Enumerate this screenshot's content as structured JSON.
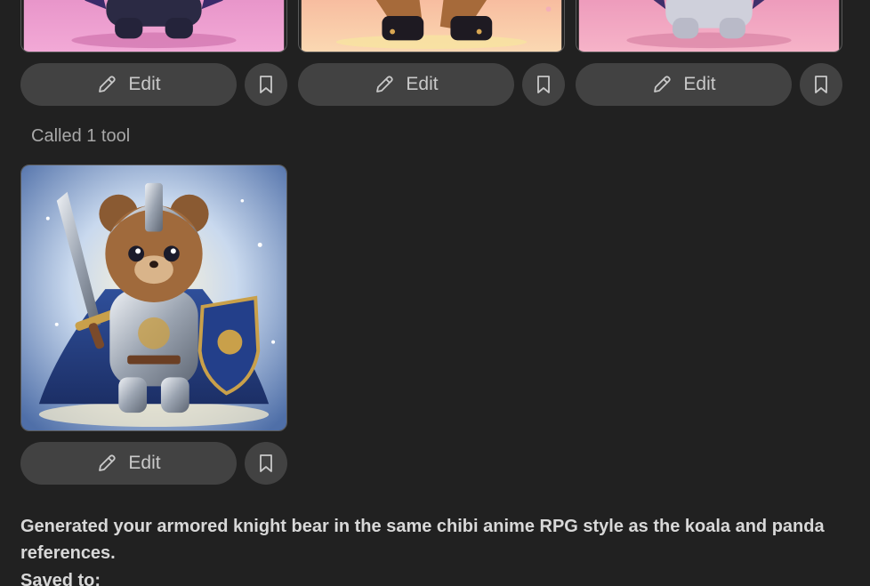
{
  "colors": {
    "background": "#212121",
    "button_bg": "#424242",
    "text_primary": "#d8d8d8",
    "text_muted": "#a8a8a8"
  },
  "gallery_top": {
    "images": [
      {
        "alt": "panda chibi character on pink background"
      },
      {
        "alt": "chibi character in furry boots on peach background"
      },
      {
        "alt": "koala chibi character on pink background"
      }
    ],
    "edit_label": "Edit",
    "edit_icon": "pencil-icon",
    "save_icon": "bookmark-icon"
  },
  "tool_note": "Called 1 tool",
  "generated": {
    "image_alt": "chibi armored knight bear with sword and lion shield",
    "edit_label": "Edit",
    "edit_icon": "pencil-icon",
    "save_icon": "bookmark-icon"
  },
  "assistant_message": "Generated your armored knight bear in the same chibi anime RPG style as the koala and panda references.",
  "saved_to_label": "Saved to:"
}
